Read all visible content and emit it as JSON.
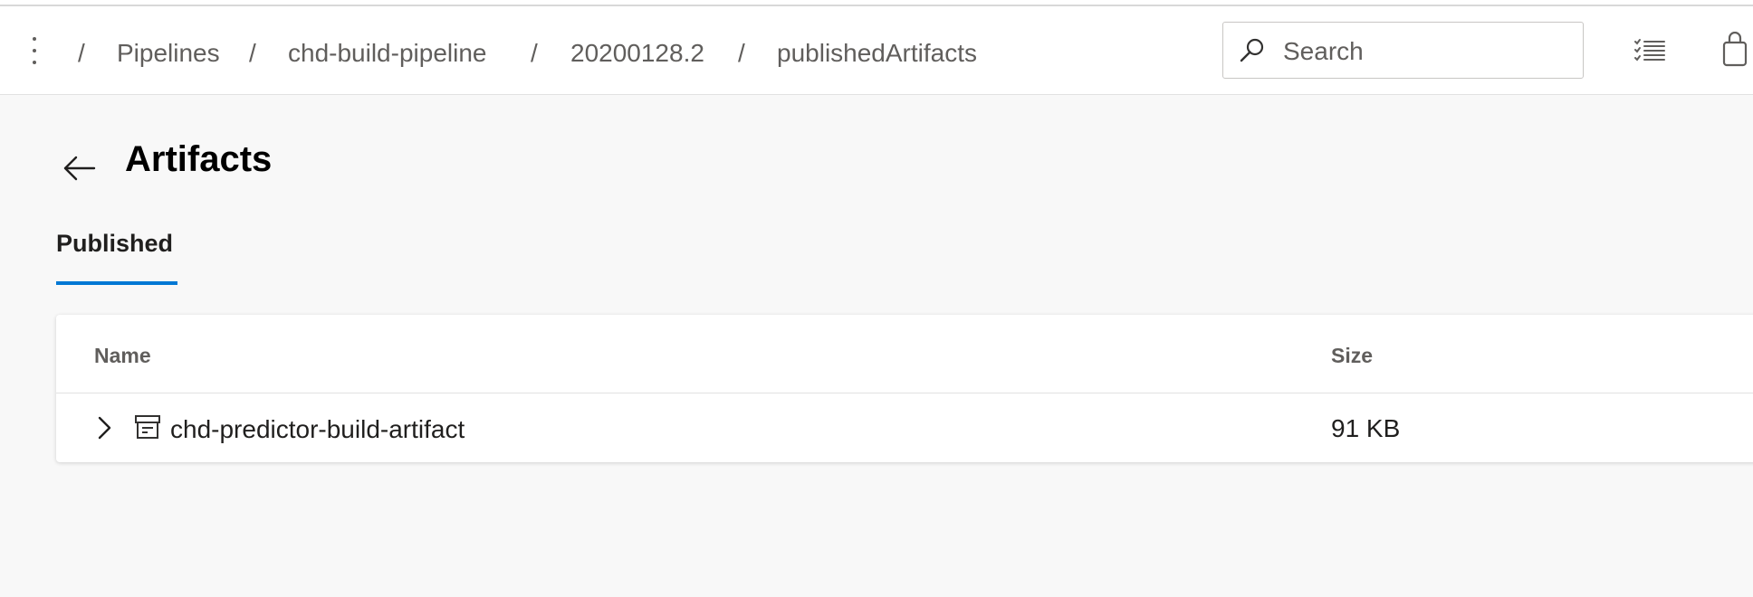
{
  "breadcrumb": {
    "items": [
      "Pipelines",
      "chd-build-pipeline",
      "20200128.2",
      "publishedArtifacts"
    ],
    "separator": "/"
  },
  "search": {
    "placeholder": "Search",
    "value": ""
  },
  "header_icons": [
    "more-vertical-icon",
    "search-icon",
    "checklist-icon",
    "shopping-bag-icon"
  ],
  "page": {
    "title": "Artifacts"
  },
  "tabs": [
    {
      "label": "Published",
      "active": true
    }
  ],
  "table": {
    "columns": [
      "Name",
      "Size"
    ],
    "rows": [
      {
        "name": "chd-predictor-build-artifact",
        "size": "91 KB",
        "expanded": false
      }
    ]
  },
  "colors": {
    "accent": "#0078d4",
    "background": "#f8f8f8",
    "text": "#323130"
  }
}
